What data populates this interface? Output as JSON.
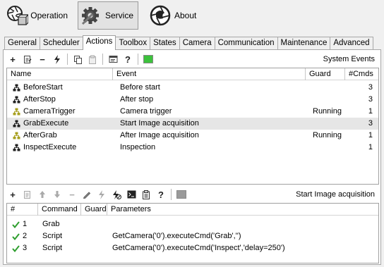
{
  "modes": {
    "operation": {
      "label": "Operation",
      "icon": "aperture-cube-icon"
    },
    "service": {
      "label": "Service",
      "icon": "gear-wrench-icon"
    },
    "about": {
      "label": "About",
      "icon": "aperture-globe-icon"
    }
  },
  "tabs": [
    "General",
    "Scheduler",
    "Actions",
    "Toolbox",
    "States",
    "Camera",
    "Communication",
    "Maintenance",
    "Advanced"
  ],
  "active_tab": "Actions",
  "actions_toolbar": {
    "status_label": "System Events"
  },
  "actions_table": {
    "columns": [
      "Name",
      "Event",
      "Guard",
      "#Cmds"
    ],
    "rows": [
      {
        "name": "BeforeStart",
        "event": "Before start",
        "guard": "",
        "cmds": "3",
        "selected": false
      },
      {
        "name": "AfterStop",
        "event": "After stop",
        "guard": "",
        "cmds": "3",
        "selected": false
      },
      {
        "name": "CameraTrigger",
        "event": "Camera trigger",
        "guard": "Running",
        "cmds": "1",
        "selected": false
      },
      {
        "name": "GrabExecute",
        "event": "Start Image acquisition",
        "guard": "",
        "cmds": "3",
        "selected": true
      },
      {
        "name": "AfterGrab",
        "event": "After Image acquisition",
        "guard": "Running",
        "cmds": "1",
        "selected": false
      },
      {
        "name": "InspectExecute",
        "event": "Inspection",
        "guard": "",
        "cmds": "1",
        "selected": false
      }
    ]
  },
  "commands_toolbar": {
    "status_label": "Start Image acquisition"
  },
  "commands_table": {
    "columns": [
      "#",
      "Command",
      "Guard",
      "Parameters"
    ],
    "rows": [
      {
        "num": "1",
        "command": "Grab",
        "guard": "",
        "params": ""
      },
      {
        "num": "2",
        "command": "Script",
        "guard": "",
        "params": "GetCamera('0').executeCmd('Grab','')"
      },
      {
        "num": "3",
        "command": "Script",
        "guard": "",
        "params": "GetCamera('0').executeCmd('Inspect','delay=250')"
      }
    ]
  },
  "colors": {
    "accent_green": "#3cc23c",
    "selection": "#e6e6e6",
    "check_green": "#2e9e2e"
  }
}
